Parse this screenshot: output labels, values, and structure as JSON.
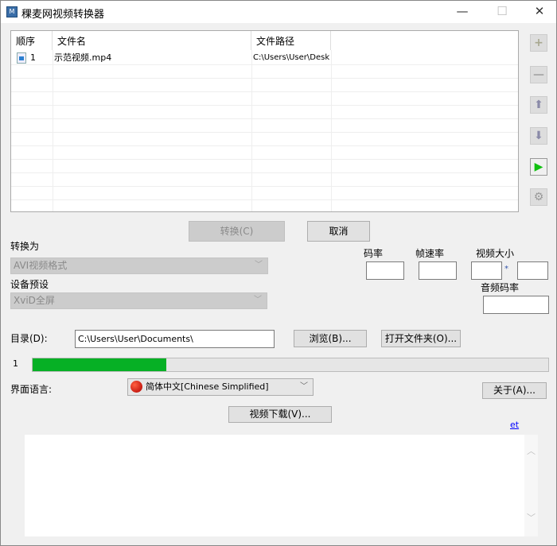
{
  "window": {
    "title": "稞麦网视频转换器",
    "minimize": "—",
    "maximize": "☐",
    "close": "✕"
  },
  "list": {
    "headers": [
      "顺序",
      "文件名",
      "文件路径"
    ],
    "rows": [
      {
        "index": "1",
        "name": "示范视频.mp4",
        "path": "C:\\Users\\User\\Desk"
      }
    ]
  },
  "side_buttons": [
    "add",
    "remove",
    "move-up",
    "move-down",
    "play",
    "settings"
  ],
  "buttons": {
    "convert": "转换(C)",
    "cancel": "取消",
    "browse": "浏览(B)...",
    "open_folder": "打开文件夹(O)...",
    "about": "关于(A)...",
    "video_download": "视频下载(V)..."
  },
  "convert_to": {
    "label": "转换为",
    "value": "AVI视频格式"
  },
  "device_preset": {
    "label": "设备预设",
    "value": "XviD全屏"
  },
  "params": {
    "bitrate": "码率",
    "framerate": "帧速率",
    "video_size": "视频大小",
    "times": "*",
    "audio_bitrate": "音频码率"
  },
  "directory": {
    "label": "目录(D):",
    "value": "C:\\Users\\User\\Documents\\"
  },
  "progress": {
    "label": "1",
    "percent": 26,
    "color": "#06b025"
  },
  "language": {
    "label": "界面语言:",
    "value": "简体中文[Chinese Simplified]"
  },
  "link": "et"
}
